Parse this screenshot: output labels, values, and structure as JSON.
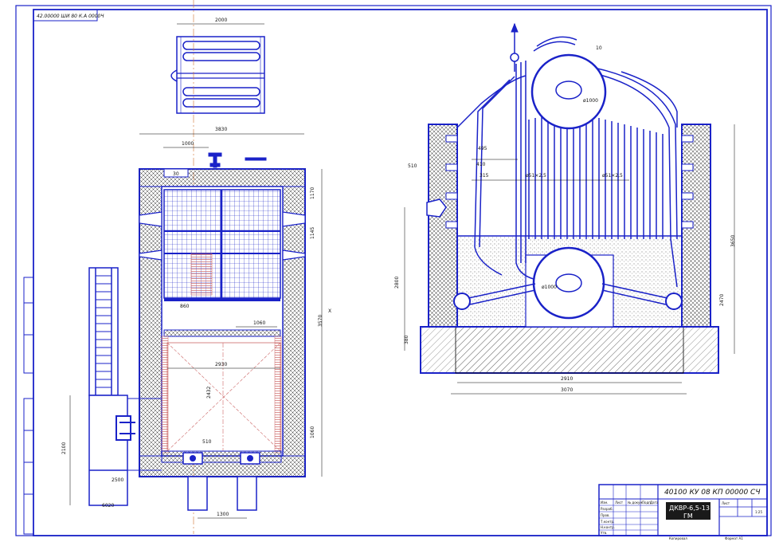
{
  "sheet": {
    "corner_stamp": "42.00000 ШИ 80 К.А 0000Ч"
  },
  "plan_view": {
    "dims": {
      "top_width": "2000",
      "overall_width": "3830",
      "inner_width": "2930",
      "hatch_width": "1060",
      "burner_offset": "1000",
      "left_inner": "860",
      "grate": "510",
      "foot_spacing": "1300",
      "right_v1": "1170",
      "right_v2": "1145",
      "right_v3": "3570",
      "right_v4": "1060",
      "inner_v": "2432",
      "stair_h": "2100",
      "stair_w": "2500",
      "stair_bottom": "6020"
    },
    "axis_label": "X"
  },
  "section_view": {
    "dims": {
      "drum_top": "ø1000",
      "drum_bottom": "ø1000",
      "d1": "495",
      "d2": "410",
      "d3": "315",
      "d4": "510",
      "tube1": "ø51×2,5",
      "tube2": "ø51×2,5",
      "base_h": "380",
      "left_h": "2800",
      "right_h1": "3650",
      "right_h2": "2470",
      "bottom_w1": "2910",
      "bottom_w2": "3070",
      "leader": "10"
    }
  },
  "title_block": {
    "code": "40100 КУ 08 КП 00000 СЧ",
    "label_block": "ДКВР-6,5-13",
    "label_sub": "ГМ",
    "scale": "1:25",
    "stage": "Лист",
    "rows": [
      "Изм.",
      "Лист",
      "№ докум.",
      "Подп.",
      "Дата",
      "Разраб.",
      "Пров.",
      "Т.контр.",
      "Н.контр.",
      "Утв."
    ],
    "format_left": "Копировал",
    "format_right": "Формат  A1"
  }
}
